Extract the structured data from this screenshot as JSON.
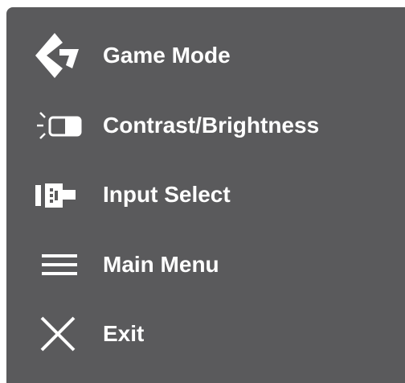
{
  "osd_menu": {
    "items": [
      {
        "label": "Game Mode",
        "icon": "game-mode-icon"
      },
      {
        "label": "Contrast/Brightness",
        "icon": "contrast-brightness-icon"
      },
      {
        "label": "Input Select",
        "icon": "input-select-icon"
      },
      {
        "label": "Main Menu",
        "icon": "main-menu-icon"
      },
      {
        "label": "Exit",
        "icon": "exit-icon"
      }
    ]
  },
  "colors": {
    "panel_background": "#5a5a5c",
    "text": "#ffffff",
    "page_background": "#ffffff"
  }
}
